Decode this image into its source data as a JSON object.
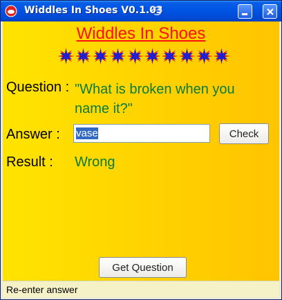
{
  "window": {
    "title": "Widdles In Shoes V0.1.03"
  },
  "app": {
    "heading": "Widdles In Shoes",
    "star_count": 10,
    "colors": {
      "star_fill": "#2020d0",
      "star_burst": "#e01010",
      "question": "#0a7a3a",
      "heading": "#ff1010"
    }
  },
  "form": {
    "question_label": "Question :",
    "question_text": "\"What is broken when you name it?\"",
    "answer_label": "Answer :",
    "answer_value": "vase",
    "check_label": "Check",
    "result_label": "Result :",
    "result_value": "Wrong",
    "get_question_label": "Get Question"
  },
  "status": {
    "text": "Re-enter answer"
  },
  "icons": [
    "app-icon",
    "graphics-icon",
    "minimize-icon",
    "close-icon",
    "star-icon"
  ]
}
